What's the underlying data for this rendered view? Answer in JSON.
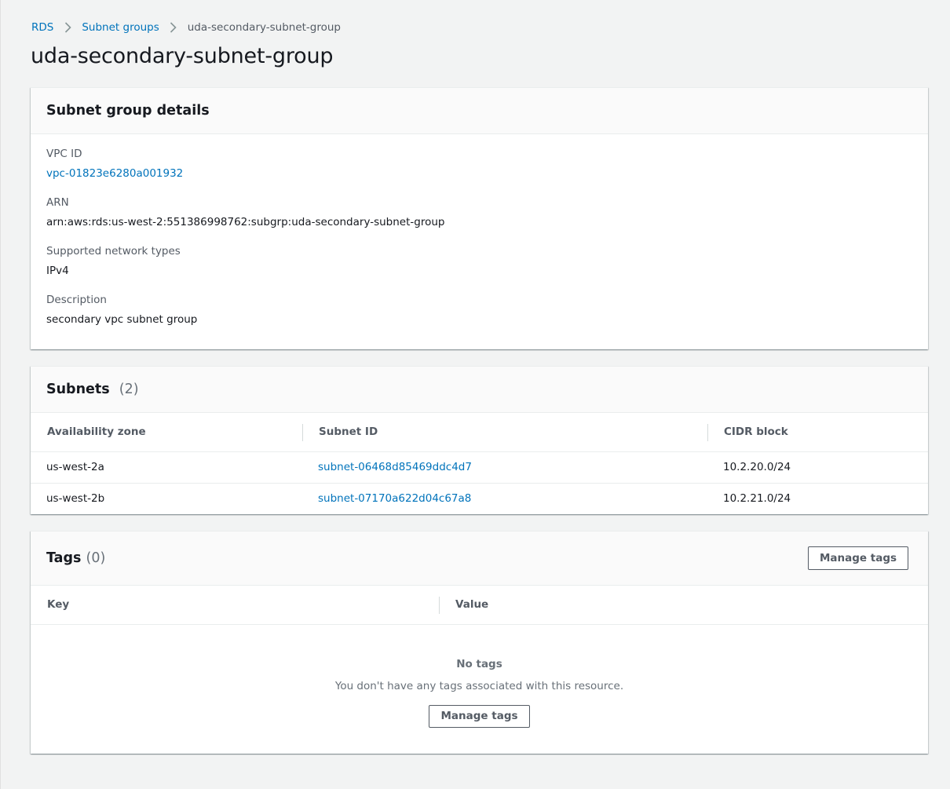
{
  "breadcrumb": {
    "items": [
      "RDS",
      "Subnet groups"
    ],
    "current": "uda-secondary-subnet-group"
  },
  "page_title": "uda-secondary-subnet-group",
  "details": {
    "title": "Subnet group details",
    "vpc_id_label": "VPC ID",
    "vpc_id_value": "vpc-01823e6280a001932",
    "arn_label": "ARN",
    "arn_value": "arn:aws:rds:us-west-2:551386998762:subgrp:uda-secondary-subnet-group",
    "network_types_label": "Supported network types",
    "network_types_value": "IPv4",
    "description_label": "Description",
    "description_value": "secondary vpc subnet group"
  },
  "subnets": {
    "title": "Subnets",
    "count": "(2)",
    "columns": [
      "Availability zone",
      "Subnet ID",
      "CIDR block"
    ],
    "rows": [
      {
        "az": "us-west-2a",
        "subnet_id": "subnet-06468d85469ddc4d7",
        "cidr": "10.2.20.0/24"
      },
      {
        "az": "us-west-2b",
        "subnet_id": "subnet-07170a622d04c67a8",
        "cidr": "10.2.21.0/24"
      }
    ]
  },
  "tags": {
    "title": "Tags",
    "count": "(0)",
    "manage_label": "Manage tags",
    "columns": [
      "Key",
      "Value"
    ],
    "empty_title": "No tags",
    "empty_message": "You don't have any tags associated with this resource.",
    "empty_button_label": "Manage tags"
  },
  "colors": {
    "link": "#0073bb",
    "background": "#f2f3f3",
    "panel_header": "#fafafa"
  }
}
